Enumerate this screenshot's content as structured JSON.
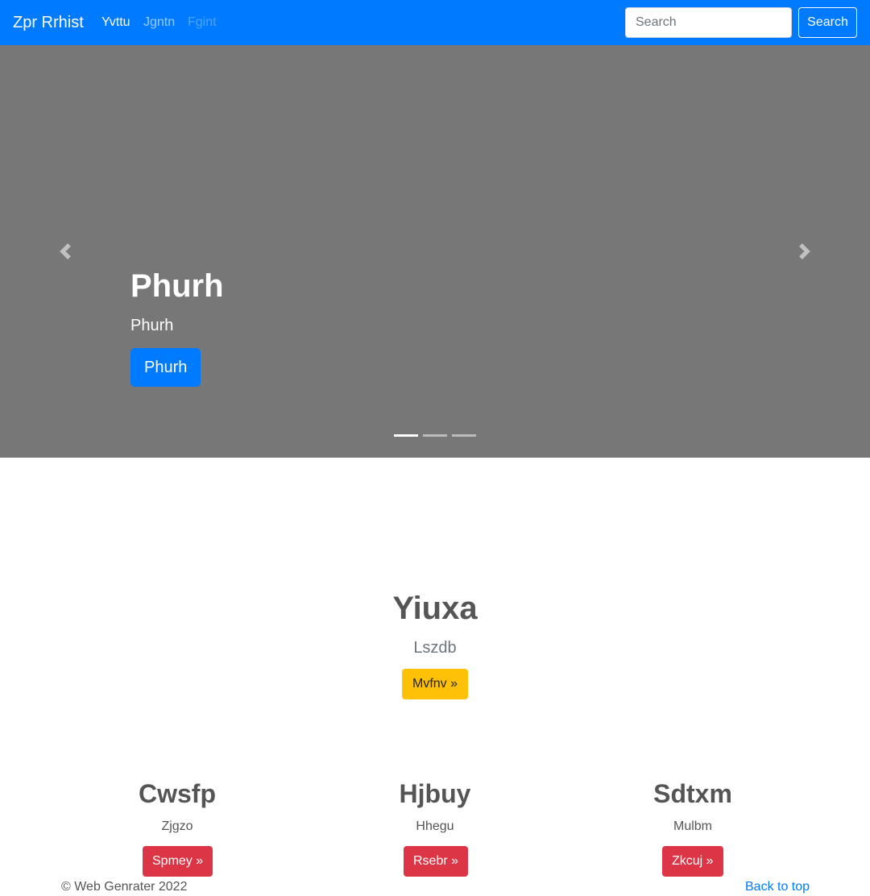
{
  "navbar": {
    "brand": "Zpr Rrhist",
    "links": [
      {
        "label": "Yvttu",
        "state": "active"
      },
      {
        "label": "Jgntn",
        "state": "normal"
      },
      {
        "label": "Fgint",
        "state": "disabled"
      }
    ],
    "search_placeholder": "Search",
    "search_button": "Search",
    "color": "#007bff"
  },
  "carousel": {
    "background": "#777777",
    "heading": "Phurh",
    "text": "Phurh",
    "button_label": "Phurh",
    "prev_icon": "chevron-left-icon",
    "next_icon": "chevron-right-icon",
    "indicators": [
      {
        "active": true
      },
      {
        "active": false
      },
      {
        "active": false
      }
    ]
  },
  "hero": {
    "heading": "Yiuxa",
    "lead": "Lszdb",
    "button_label": "Mvfnv »",
    "button_color": "#ffc107"
  },
  "columns": [
    {
      "heading": "Cwsfp",
      "text": "Zjgzo",
      "button_label": "Spmey »"
    },
    {
      "heading": "Hjbuy",
      "text": "Hhegu",
      "button_label": "Rsebr »"
    },
    {
      "heading": "Sdtxm",
      "text": "Mulbm",
      "button_label": "Zkcuj »"
    }
  ],
  "column_button_color": "#dc3545",
  "footer": {
    "copyright": "© Web Genrater 2022",
    "back_to_top": "Back to top"
  }
}
